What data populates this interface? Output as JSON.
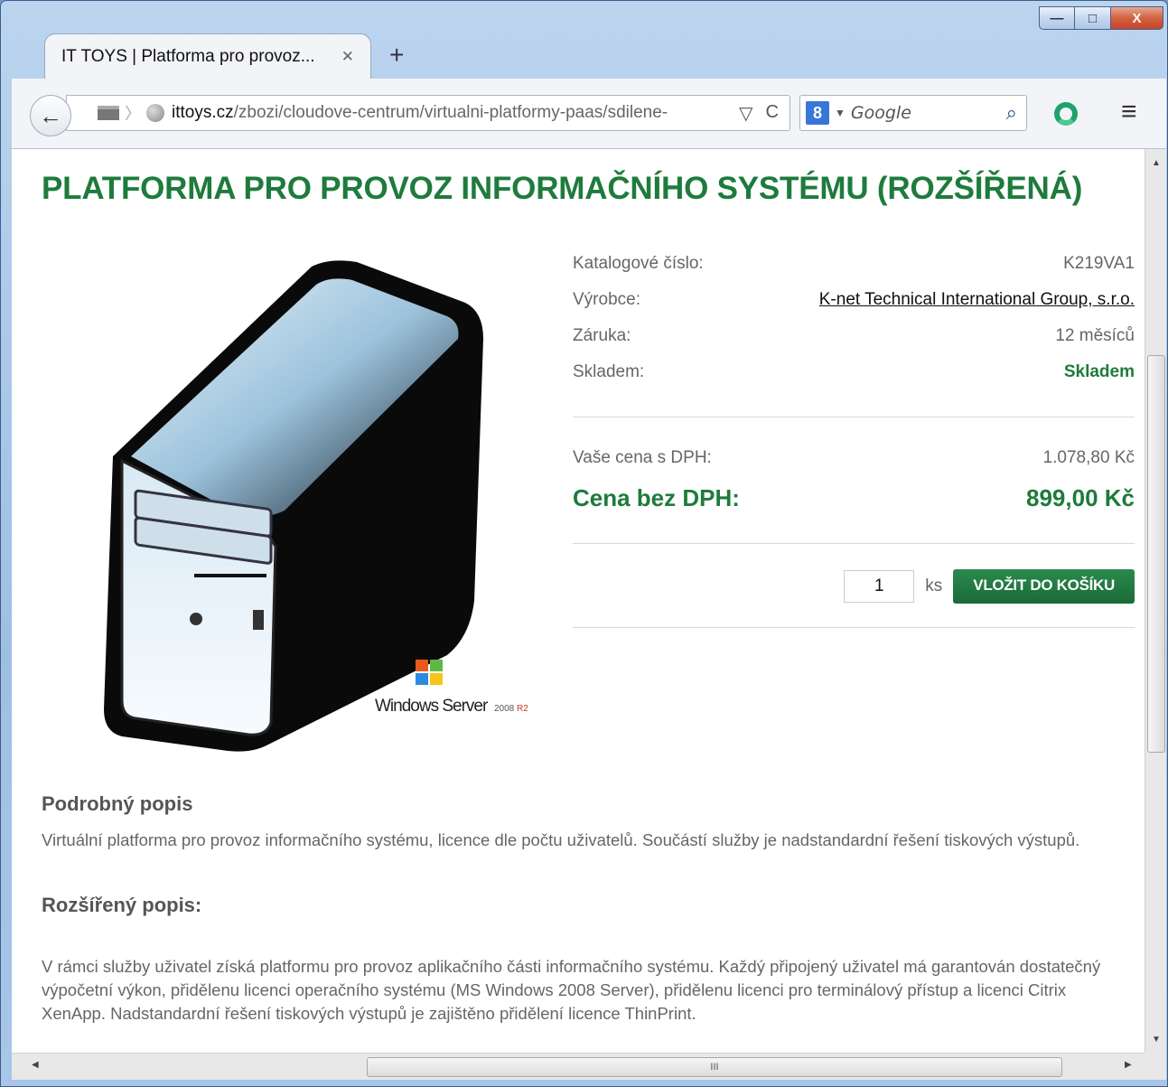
{
  "window": {
    "controls": {
      "minimize": "—",
      "maximize": "□",
      "close": "X"
    }
  },
  "tab": {
    "title": "IT TOYS | Platforma pro provoz...",
    "close": "✕",
    "new_tab": "+"
  },
  "navbar": {
    "back": "←",
    "url_domain": "ittoys.cz",
    "url_path": "/zbozi/cloudove-centrum/virtualni-platformy-paas/sdilene-",
    "dropdown": "▽",
    "reload": "C",
    "search_engine_letter": "8",
    "search_placeholder": "Google",
    "search_go": "⌕",
    "menu": "≡"
  },
  "page": {
    "title": "PLATFORMA PRO PROVOZ INFORMAČNÍHO SYSTÉMU (ROZŠÍŘENÁ)",
    "image_brand": "Windows Server",
    "image_version": "2008",
    "image_edition": "R2",
    "details": [
      {
        "label": "Katalogové číslo:",
        "value": "K219VA1"
      },
      {
        "label": "Výrobce:",
        "value": "K-net Technical International Group, s.r.o."
      },
      {
        "label": "Záruka:",
        "value": "12 měsíců"
      },
      {
        "label": "Skladem:",
        "value": "Skladem"
      }
    ],
    "price_with_vat_label": "Vaše cena s DPH:",
    "price_with_vat": "1.078,80 Kč",
    "price_without_vat_label": "Cena bez DPH:",
    "price_without_vat": "899,00 Kč",
    "quantity": "1",
    "unit": "ks",
    "add_to_cart": "VLOŽIT DO KOŠÍKU",
    "detail_heading": "Podrobný popis",
    "detail_text": "Virtuální platforma pro provoz informačního systému, licence dle počtu uživatelů. Součástí služby je nadstandardní řešení tiskových výstupů.",
    "extended_heading": "Rozšířený popis:",
    "extended_text": "V rámci služby uživatel získá platformu pro provoz aplikačního části informačního systému. Každý připojený uživatel má garantován dostatečný výpočetní výkon, přidělenu licenci operačního systému (MS Windows 2008 Server), přidělenu licenci pro terminálový přístup a licenci Citrix XenApp. Nadstandardní řešení tiskových výstupů je zajištěno přidělení licence ThinPrint."
  },
  "colors": {
    "accent_green": "#1e7b3c",
    "text_gray": "#666666"
  }
}
